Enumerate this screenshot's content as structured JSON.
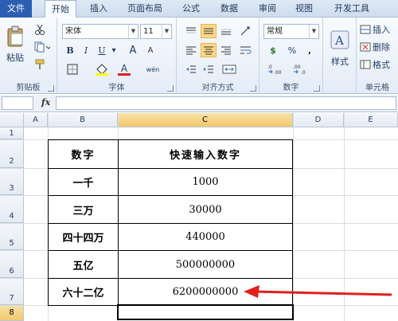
{
  "menu": {
    "tabs": [
      "文件",
      "开始",
      "插入",
      "页面布局",
      "公式",
      "数据",
      "审阅",
      "视图",
      "开发工具"
    ],
    "active_tab": "开始"
  },
  "ribbon": {
    "clipboard": {
      "paste": "粘贴",
      "group_label": "剪贴板"
    },
    "font": {
      "font_name": "宋体",
      "font_size": "11",
      "bold": "B",
      "italic": "I",
      "underline": "U",
      "grow": "A",
      "shrink": "A",
      "font_color": "A",
      "phonetic": "wén",
      "group_label": "字体"
    },
    "alignment": {
      "group_label": "对齐方式"
    },
    "number": {
      "format": "常规",
      "currency": "$",
      "percent": "%",
      "comma": ",",
      "group_label": "数字"
    },
    "styles": {
      "label": "样式"
    },
    "cells": {
      "insert": "插入",
      "delete": "删除",
      "format": "格式",
      "group_label": "单元格"
    }
  },
  "formula_bar": {
    "fx": "fx",
    "value": ""
  },
  "grid": {
    "columns": [
      "A",
      "B",
      "C",
      "D",
      "E"
    ],
    "selected_column": "C",
    "rows": [
      "1",
      "2",
      "3",
      "4",
      "5",
      "6",
      "7",
      "8"
    ],
    "selected_row": "8"
  },
  "table": {
    "headers": [
      "数字",
      "快速输入数字"
    ],
    "rows": [
      {
        "label": "一千",
        "value": "1000"
      },
      {
        "label": "三万",
        "value": "30000"
      },
      {
        "label": "四十四万",
        "value": "440000"
      },
      {
        "label": "五亿",
        "value": "500000000"
      },
      {
        "label": "六十二亿",
        "value": "6200000000"
      }
    ]
  },
  "colors": {
    "accent": "#2a5eb0",
    "arrow": "#e02020",
    "selection": "#f3c86c"
  }
}
